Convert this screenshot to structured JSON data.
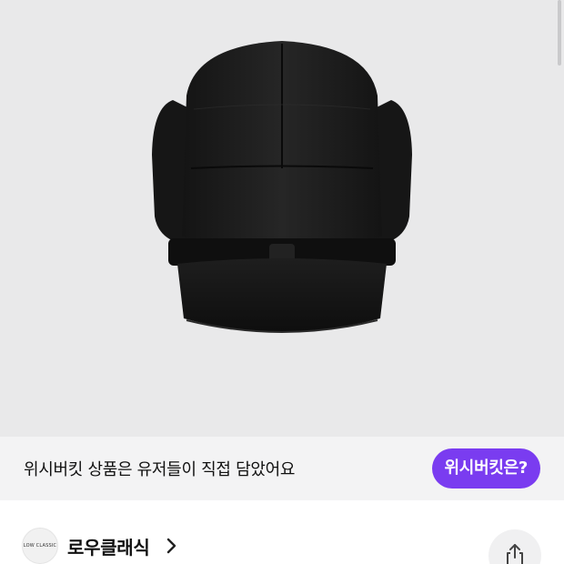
{
  "banner": {
    "text": "위시버킷 상품은 유저들이 직접 담았어요",
    "button_label": "위시버킷은?"
  },
  "brand": {
    "name": "로우클래식",
    "logo_text": "LOW CLASSIC"
  },
  "icons": {
    "brand_chevron": "chevron-right-icon",
    "share": "share-icon"
  },
  "colors": {
    "accent": "#7a3cf0",
    "banner_background": "#f3f3f4",
    "image_background": "#e9e9ea"
  }
}
